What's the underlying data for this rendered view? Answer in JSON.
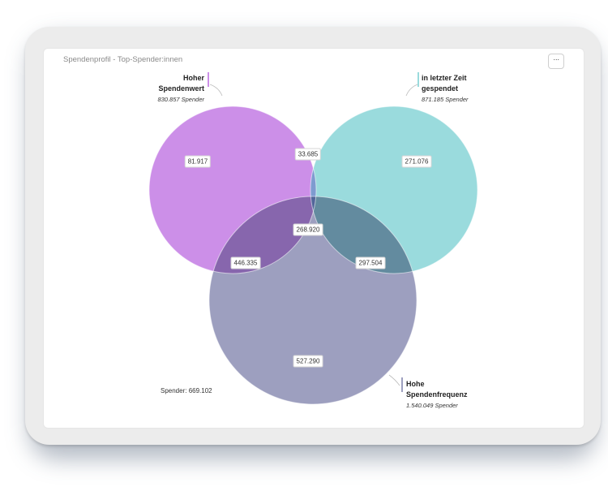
{
  "widget": {
    "title": "Spendenprofil - Top-Spender:innen",
    "menu_icon": "more-horizontal-icon",
    "menu_label": "···"
  },
  "chart_data": {
    "type": "venn",
    "sets": [
      {
        "name_line1": "Hoher",
        "name_line2": "Spendenwert",
        "count_label": "830.857 Spender",
        "size": 830857,
        "color": "#cc8fe8"
      },
      {
        "name_line1": "in letzter Zeit",
        "name_line2": "gespendet",
        "count_label": "871.185 Spender",
        "size": 871185,
        "color": "#9adbdd"
      },
      {
        "name_line1": "Hohe",
        "name_line2": "Spendenfrequenz",
        "count_label": "1.540.049 Spender",
        "size": 1540049,
        "color": "#9d9fbf"
      }
    ],
    "regions": {
      "only_wert": {
        "value": 81917,
        "label": "81.917"
      },
      "wert_zeit": {
        "value": 33685,
        "label": "33.685"
      },
      "only_zeit": {
        "value": 271076,
        "label": "271.076"
      },
      "all_three": {
        "value": 268920,
        "label": "268.920"
      },
      "wert_freq": {
        "value": 446335,
        "label": "446.335"
      },
      "zeit_freq": {
        "value": 297504,
        "label": "297.504"
      },
      "only_freq": {
        "value": 527290,
        "label": "527.290"
      }
    },
    "total_label": "Spender:",
    "total_value": "669.102",
    "colors": {
      "wert_zeit": "#7e9bd0",
      "wert_freq": "#8766ad",
      "zeit_freq": "#638b9f",
      "all_three": "#52669a"
    }
  }
}
